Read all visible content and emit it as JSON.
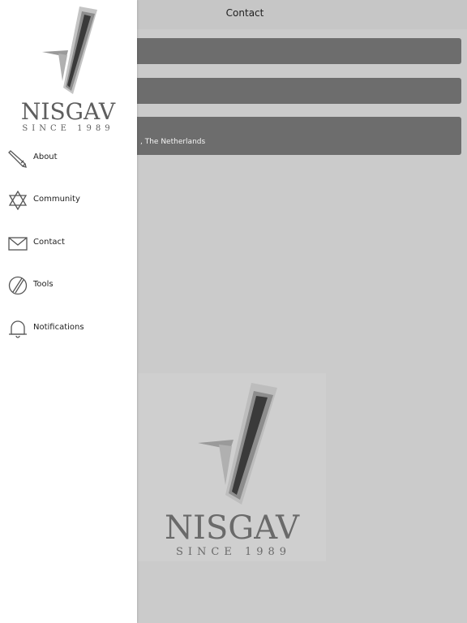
{
  "header": {
    "title": "Contact"
  },
  "cards": [
    {
      "text": ""
    },
    {
      "text": ""
    },
    {
      "text": ", The Netherlands"
    }
  ],
  "logo": {
    "brand": "NISGAV",
    "tagline": "SINCE 1989"
  },
  "drawer": {
    "items": [
      {
        "label": "About",
        "icon": "pencil-icon"
      },
      {
        "label": "Community",
        "icon": "star-of-david-icon"
      },
      {
        "label": "Contact",
        "icon": "envelope-icon"
      },
      {
        "label": "Tools",
        "icon": "slash-circle-icon"
      },
      {
        "label": "Notifications",
        "icon": "bell-icon"
      }
    ]
  },
  "colors": {
    "background": "#cbcbcb",
    "card": "#6d6d6d",
    "drawer": "#ffffff"
  }
}
